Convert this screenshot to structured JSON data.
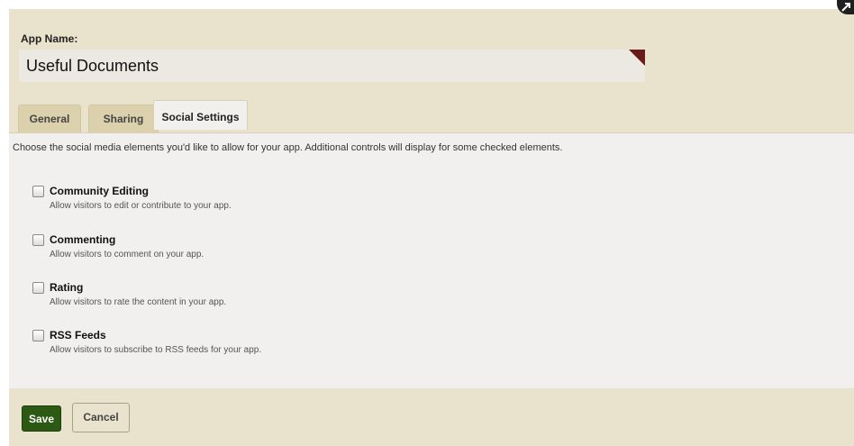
{
  "app": {
    "label": "App Name:",
    "name_value": "Useful Documents"
  },
  "tabs": [
    {
      "label": "General",
      "active": false
    },
    {
      "label": "Sharing",
      "active": false
    },
    {
      "label": "Social Settings",
      "active": true
    }
  ],
  "social": {
    "intro": "Choose the social media elements you'd like to allow for your app. Additional controls will display for some checked elements.",
    "options": [
      {
        "title": "Community Editing",
        "description": "Allow visitors to edit or contribute to your app.",
        "checked": false
      },
      {
        "title": "Commenting",
        "description": "Allow visitors to comment on your app.",
        "checked": false
      },
      {
        "title": "Rating",
        "description": "Allow visitors to rate the content in your app.",
        "checked": false
      },
      {
        "title": "RSS Feeds",
        "description": "Allow visitors to subscribe to RSS feeds for your app.",
        "checked": false
      }
    ]
  },
  "actions": {
    "save_label": "Save",
    "cancel_label": "Cancel"
  },
  "colors": {
    "panel_bg": "#e9e2cc",
    "save_green": "#2c5a15",
    "flag": "#6b1a1a"
  },
  "icons": {
    "corner": "expand-icon"
  }
}
